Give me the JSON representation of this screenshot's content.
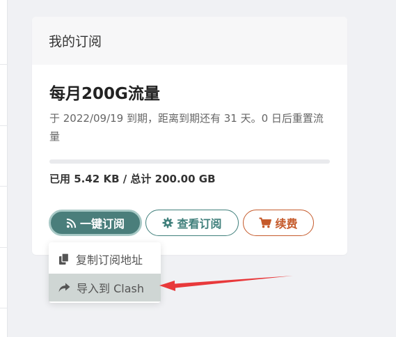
{
  "card": {
    "header_title": "我的订阅",
    "plan_name": "每月200G流量",
    "description": "于 2022/09/19 到期，距离到期还有 31 天。0 日后重置流量",
    "usage_text": "已用 5.42 KB / 总计 200.00 GB",
    "usage_fraction": 3e-08
  },
  "buttons": {
    "one_click_subscribe": "一键订阅",
    "view_subscription": "查看订阅",
    "renew": "续费"
  },
  "dropdown": {
    "copy_link": "复制订阅地址",
    "import_clash": "导入到 Clash"
  },
  "icons": {
    "rss": "rss-icon",
    "gear": "gear-icon",
    "cart": "cart-icon",
    "copy": "copy-icon",
    "share": "share-icon"
  },
  "colors": {
    "primary": "#4a7e7b",
    "renew": "#c55a2b",
    "annotation_arrow": "#e8393b"
  }
}
